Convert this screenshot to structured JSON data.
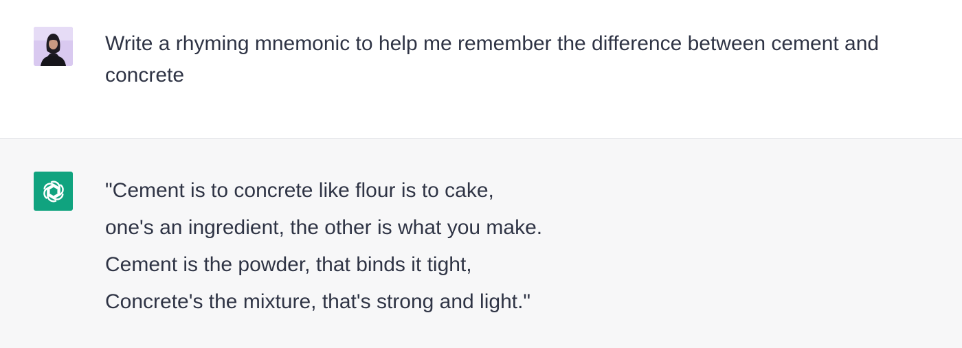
{
  "conversation": {
    "user_message": {
      "avatar": "user-avatar-photo",
      "text": "Write a rhyming mnemonic to help me remember the difference between cement and concrete"
    },
    "assistant_message": {
      "avatar": "openai-logo-icon",
      "lines": [
        "\"Cement is to concrete like flour is to cake,",
        "one's an ingredient, the other is what you make.",
        "Cement is the powder, that binds it tight,",
        "Concrete's the mixture, that's strong and light.\""
      ]
    }
  },
  "colors": {
    "assistant_avatar_bg": "#10a37f",
    "assistant_row_bg": "#f7f7f8",
    "text": "#2f3445"
  }
}
